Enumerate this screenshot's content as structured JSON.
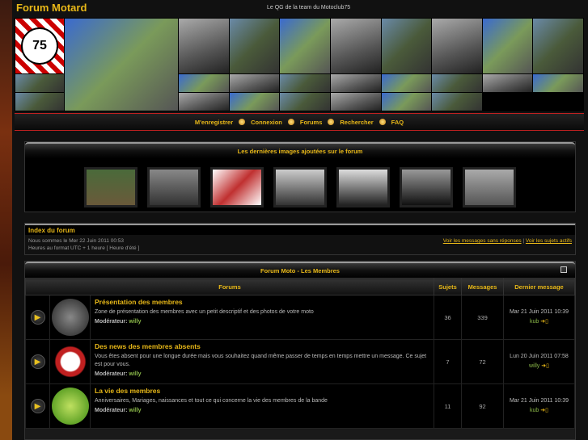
{
  "site": {
    "title": "Forum Motard",
    "description": "Le QG de la team du Motoclub75",
    "logo_text": "75"
  },
  "nav": [
    {
      "label": "M'enregistrer"
    },
    {
      "label": "Connexion"
    },
    {
      "label": "Forums"
    },
    {
      "label": "Rechercher"
    },
    {
      "label": "FAQ"
    }
  ],
  "images_box": {
    "title": "Les dernières images ajoutées sur le forum",
    "count": 7
  },
  "index": {
    "title": "Index du forum",
    "date_line": "Nous sommes le Mer 22 Juin 2011 00:53",
    "tz_line": "Heures au format UTC + 1 heure [ Heure d'été ]",
    "link_unanswered": "Voir les messages sans réponses",
    "separator": "|",
    "link_active": "Voir les sujets actifs"
  },
  "category": {
    "title": "Forum Moto - Les Membres",
    "columns": {
      "forums": "Forums",
      "topics": "Sujets",
      "posts": "Messages",
      "last": "Dernier message"
    },
    "forums": [
      {
        "title": "Présentation des membres",
        "desc": "Zone de présentation des membres avec un petit descriptif et des photos de votre moto",
        "mod_label": "Modérateur:",
        "mod": "willy",
        "topics": "36",
        "posts": "339",
        "last_date": "Mar 21 Juin 2011 10:39",
        "last_user": "kub",
        "icon": "team-members-icon"
      },
      {
        "title": "Des news des membres absents",
        "desc": "Vous êtes absent pour une longue durée mais vous souhaitez quand même passer de temps en temps mettre un message. Ce sujet est pour vous.",
        "mod_label": "Modérateur:",
        "mod": "willy",
        "topics": "7",
        "posts": "72",
        "last_date": "Lun 20 Juin 2011 07:58",
        "last_user": "willy",
        "icon": "ghost-icon"
      },
      {
        "title": "La vie des membres",
        "desc": "Anniversaires, Mariages, naissances et tout ce qui concerne la vie des membres de la bande",
        "mod_label": "Modérateur:",
        "mod": "willy",
        "topics": "11",
        "posts": "92",
        "last_date": "Mar 21 Juin 2011 10:39",
        "last_user": "kub",
        "icon": "member-life-icon"
      }
    ]
  }
}
